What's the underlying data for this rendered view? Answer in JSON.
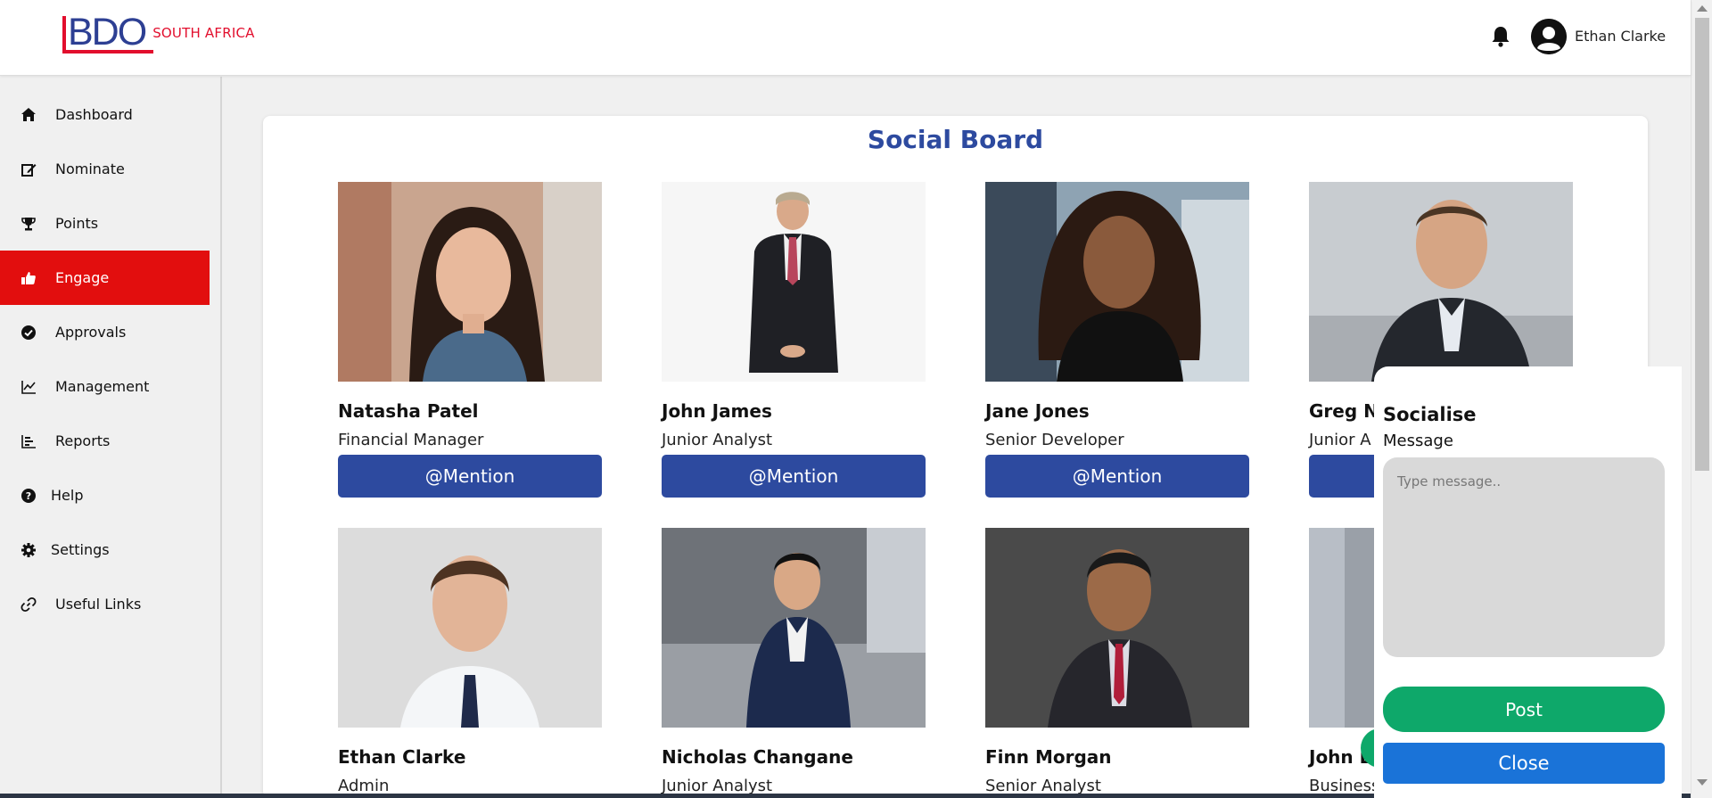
{
  "header": {
    "logo_text": "BDO",
    "logo_subtitle": "SOUTH AFRICA",
    "user_name": "Ethan Clarke"
  },
  "sidebar": {
    "items": [
      {
        "label": "Dashboard",
        "icon": "home-icon"
      },
      {
        "label": "Nominate",
        "icon": "edit-icon"
      },
      {
        "label": "Points",
        "icon": "trophy-icon"
      },
      {
        "label": "Engage",
        "icon": "thumbs-up-icon",
        "active": true
      },
      {
        "label": "Approvals",
        "icon": "check-circle-icon"
      },
      {
        "label": "Management",
        "icon": "line-chart-icon"
      },
      {
        "label": "Reports",
        "icon": "bar-list-icon"
      },
      {
        "label": "Help",
        "icon": "question-circle-icon"
      },
      {
        "label": "Settings",
        "icon": "gear-icon"
      },
      {
        "label": "Useful Links",
        "icon": "link-icon"
      }
    ]
  },
  "board": {
    "title": "Social Board",
    "mention_label": "@Mention",
    "people": [
      {
        "name": "Natasha Patel",
        "role": "Financial Manager"
      },
      {
        "name": "John James",
        "role": "Junior Analyst"
      },
      {
        "name": "Jane Jones",
        "role": "Senior Developer"
      },
      {
        "name": "Greg Ne",
        "role": "Junior A"
      },
      {
        "name": "Ethan Clarke",
        "role": "Admin"
      },
      {
        "name": "Nicholas Changane",
        "role": "Junior Analyst"
      },
      {
        "name": "Finn Morgan",
        "role": "Senior Analyst"
      },
      {
        "name": "John L",
        "role": "Business"
      }
    ]
  },
  "socialise": {
    "title": "Socialise",
    "message_label": "Message",
    "placeholder": "Type message..",
    "post_label": "Post",
    "close_label": "Close"
  },
  "colors": {
    "brand_blue": "#2d4a9f",
    "brand_red": "#e20e2d",
    "active_nav": "#e20e0e",
    "post_green": "#0ea86a",
    "close_blue": "#1a73d8"
  }
}
